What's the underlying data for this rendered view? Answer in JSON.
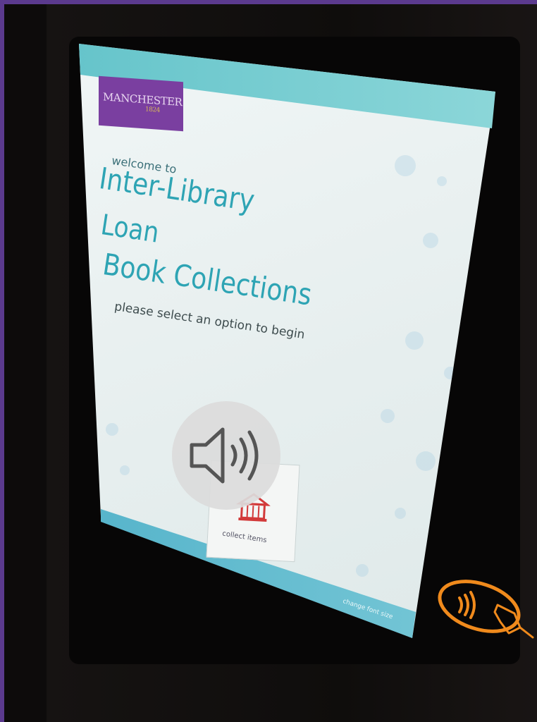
{
  "kiosk": {
    "logo": {
      "text": "MANCHESTER",
      "sub": "1824"
    },
    "welcome": "welcome to",
    "title_line1": "Inter-Library",
    "title_line2": "Loan",
    "title_line3": "Book Collections",
    "prompt": "please select an option to begin",
    "collect_label": "collect items",
    "footer_text": "change font size"
  },
  "overlay": {
    "icon": "speaker-icon"
  },
  "hardware": {
    "icon": "contactless-payment-icon",
    "accent": "#f08a1c"
  },
  "colors": {
    "title": "#2ea4b4",
    "band": "#5fc1c8",
    "logo": "#7a3fa0"
  }
}
